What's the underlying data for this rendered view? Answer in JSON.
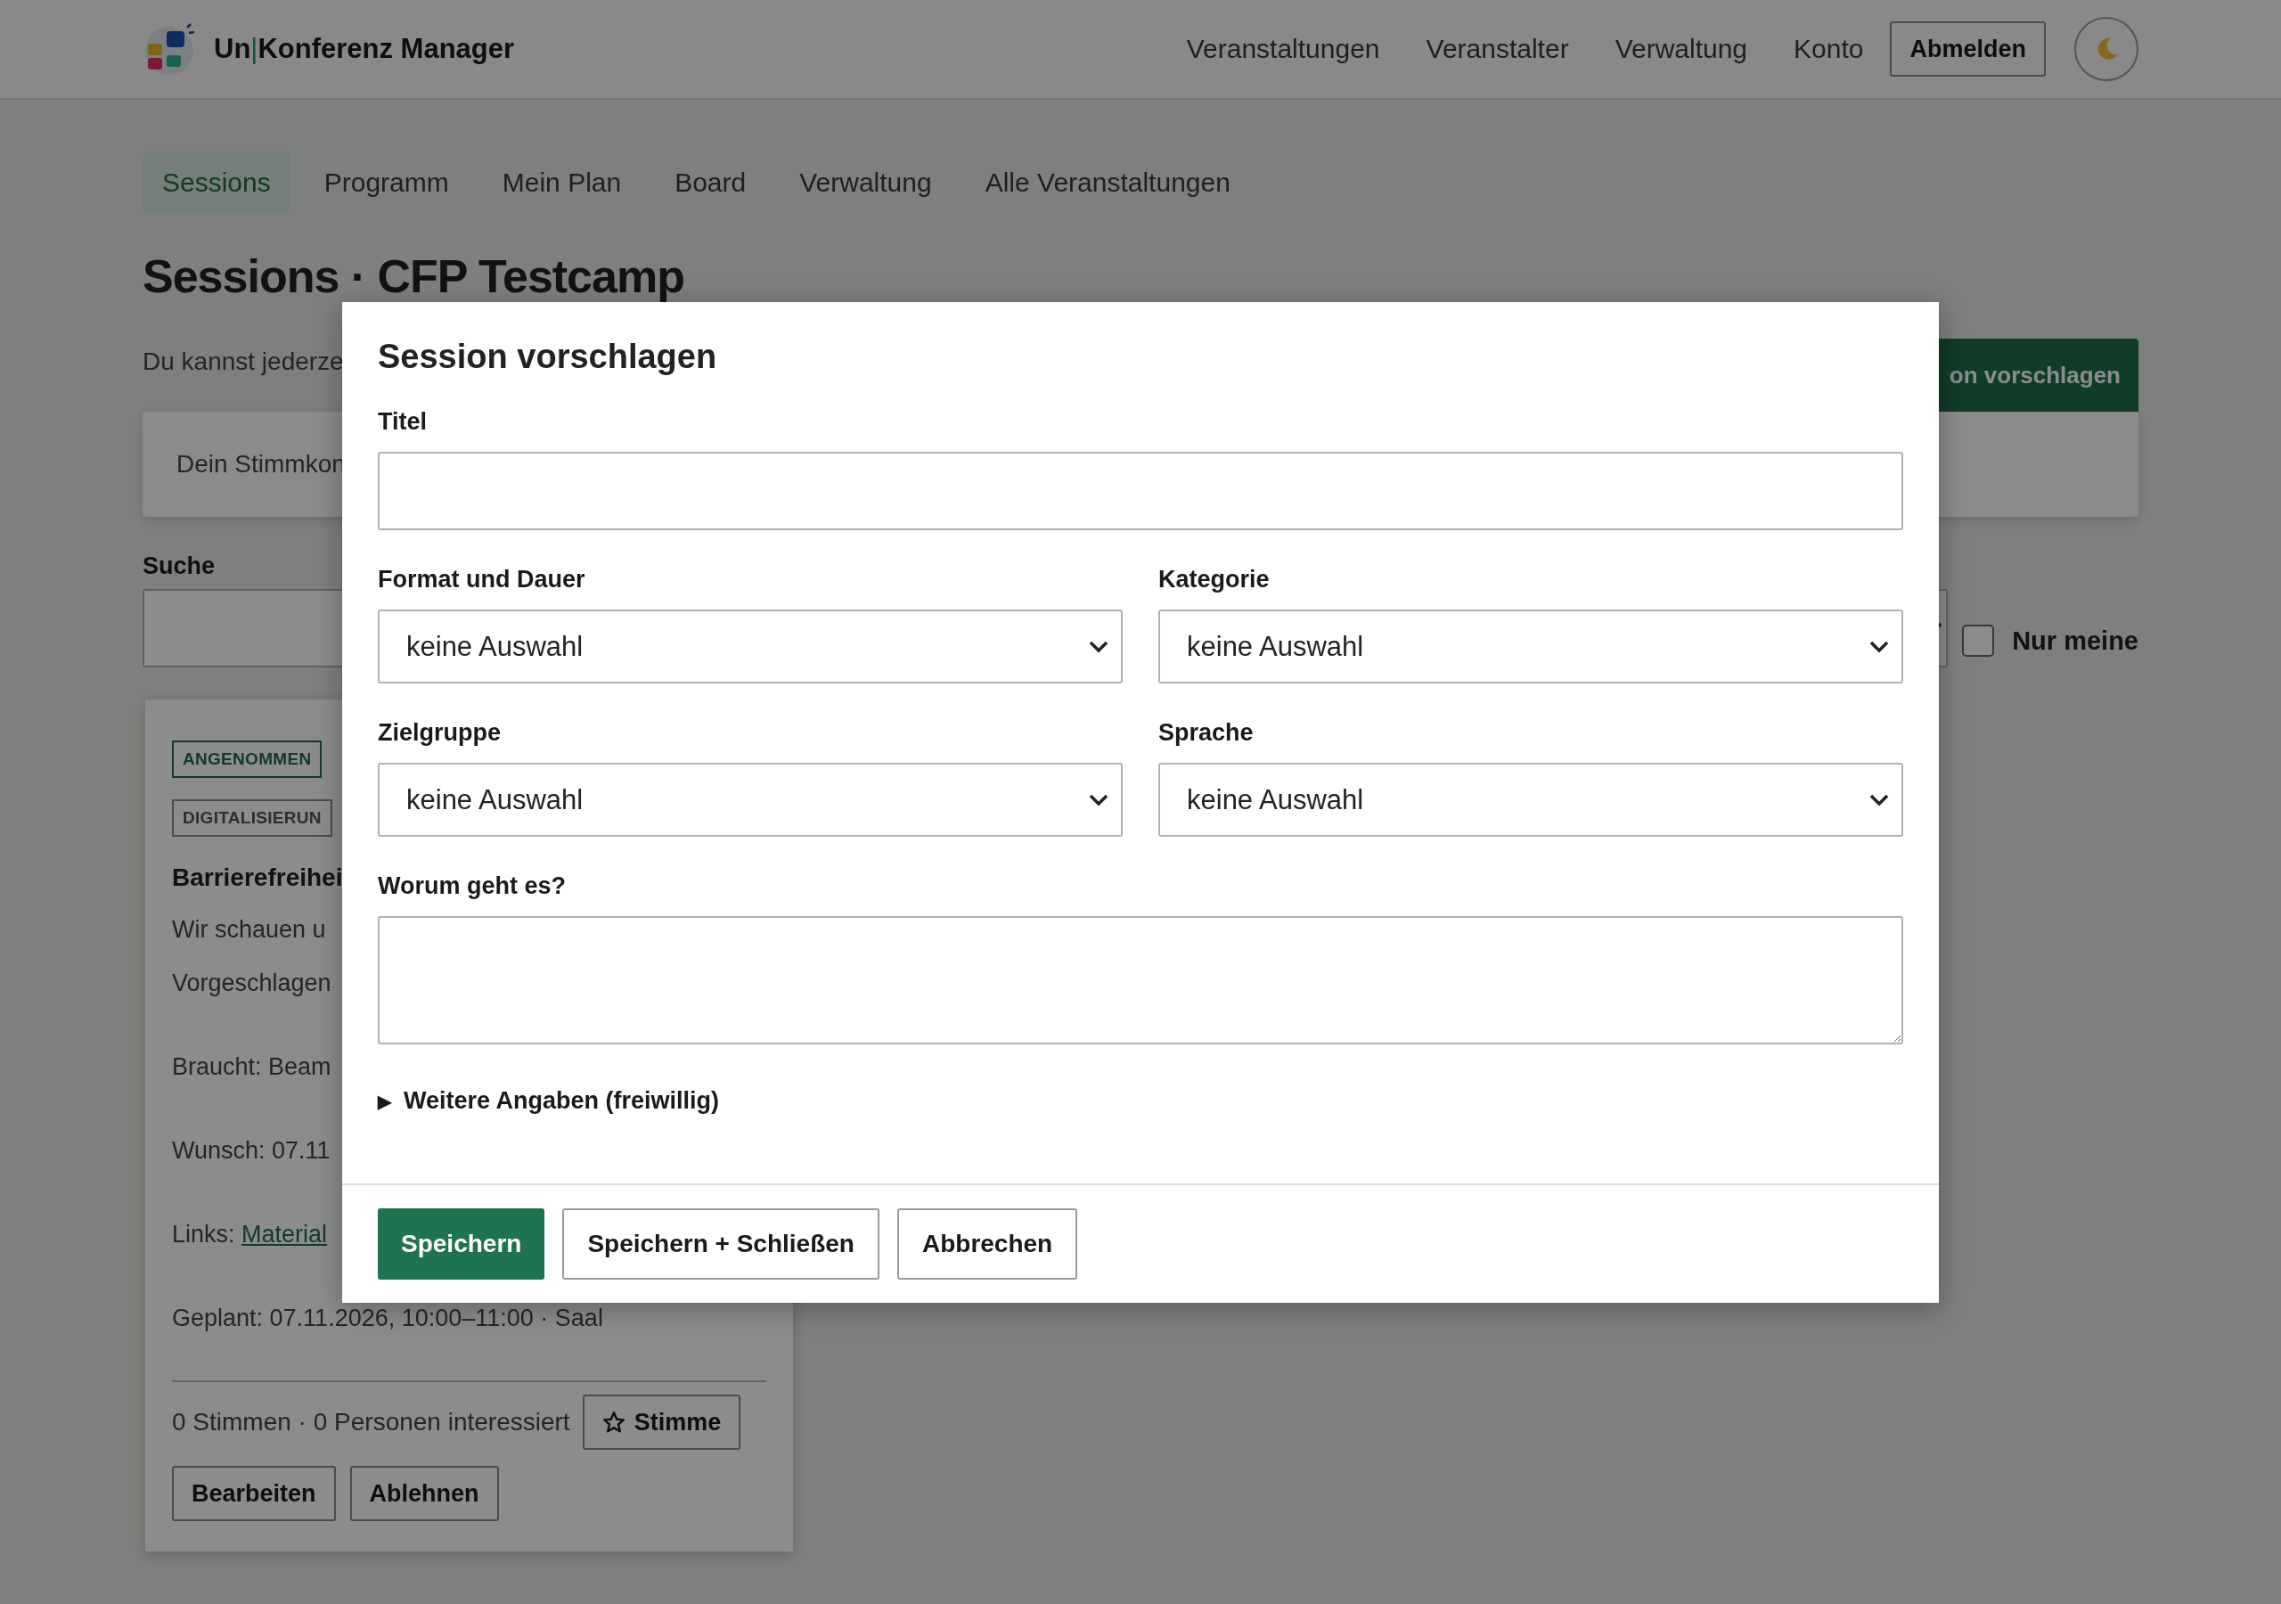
{
  "header": {
    "brand": {
      "before": "Un",
      "divider": "|",
      "after": "Konferenz Manager"
    },
    "nav": [
      "Veranstaltungen",
      "Veranstalter",
      "Verwaltung",
      "Konto"
    ],
    "logout": "Abmelden"
  },
  "tabs": [
    {
      "label": "Sessions",
      "selected": true
    },
    {
      "label": "Programm",
      "selected": false
    },
    {
      "label": "Mein Plan",
      "selected": false
    },
    {
      "label": "Board",
      "selected": false
    },
    {
      "label": "Verwaltung",
      "selected": false
    },
    {
      "label": "Alle Veranstaltungen",
      "selected": false
    }
  ],
  "page": {
    "title": "Sessions · CFP Testcamp",
    "intro": "Du kannst jederze",
    "propose_button": "on vorschlagen",
    "vote_box": "Dein Stimmkon",
    "search_label": "Suche",
    "only_mine": {
      "label": "Nur meine",
      "checked": false
    }
  },
  "session_card": {
    "tags": [
      {
        "label": "ANGENOMMEN",
        "kind": "status"
      },
      {
        "label": "DIGITALISIERUN",
        "kind": "category"
      }
    ],
    "title": "Barrierefreihei",
    "lines": [
      {
        "kind": "summary",
        "text": "Wir schauen u"
      },
      {
        "kind": "summary",
        "text": "Vorgeschlagen"
      },
      {
        "kind": "detail",
        "text": "Braucht: Beam"
      },
      {
        "kind": "detail",
        "text": "Wunsch: 07.11"
      },
      {
        "kind": "link",
        "text": "Links:",
        "link": "Material"
      },
      {
        "kind": "detail",
        "text": "Geplant: 07.11.2026, 10:00–11:00 · Saal"
      }
    ],
    "stats": "0 Stimmen · 0 Personen interessiert",
    "vote_button": "Stimme",
    "actions": [
      "Bearbeiten",
      "Ablehnen"
    ]
  },
  "modal": {
    "title": "Session vorschlagen",
    "fields": [
      {
        "kind": "text",
        "label": "Titel"
      },
      {
        "kind": "select",
        "label": "Format und Dauer",
        "value": "keine Auswahl"
      },
      {
        "kind": "select",
        "label": "Kategorie",
        "value": "keine Auswahl"
      },
      {
        "kind": "select",
        "label": "Zielgruppe",
        "value": "keine Auswahl"
      },
      {
        "kind": "select",
        "label": "Sprache",
        "value": "keine Auswahl"
      },
      {
        "kind": "textarea",
        "label": "Worum geht es?"
      }
    ],
    "more": {
      "marker": "▶",
      "label": "Weitere Angaben (freiwillig)",
      "expanded": false
    },
    "buttons": [
      {
        "label": "Speichern",
        "kind": "primary"
      },
      {
        "label": "Speichern + Schließen",
        "kind": "secondary"
      },
      {
        "label": "Abbrechen",
        "kind": "secondary"
      }
    ]
  }
}
